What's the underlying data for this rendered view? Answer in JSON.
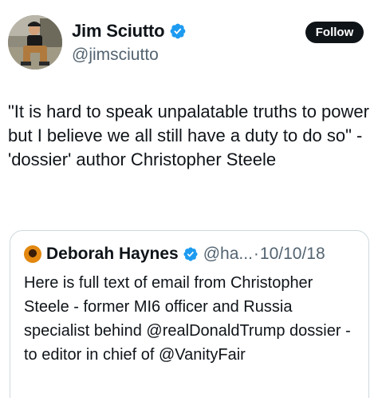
{
  "author": {
    "display_name": "Jim Sciutto",
    "handle": "@jimsciutto",
    "verified_icon": "verified-badge-icon"
  },
  "follow_button": {
    "label": "Follow"
  },
  "tweet": {
    "text": "\"It is hard to speak unpalatable truths to power but I believe we all still have a duty to do so\" -'dossier' author Christopher Steele"
  },
  "quoted_tweet": {
    "display_name": "Deborah Haynes",
    "handle": "@ha...",
    "separator": "·",
    "date": "10/10/18",
    "text": "Here is full text of email from Christopher Steele - former MI6 officer and Russia specialist behind @realDonaldTrump dossier - to editor in chief of @VanityFair"
  },
  "colors": {
    "verified_blue": "#1d9bf0",
    "follow_bg": "#0f1419",
    "secondary_text": "#536471",
    "card_border": "#cfd9de"
  }
}
